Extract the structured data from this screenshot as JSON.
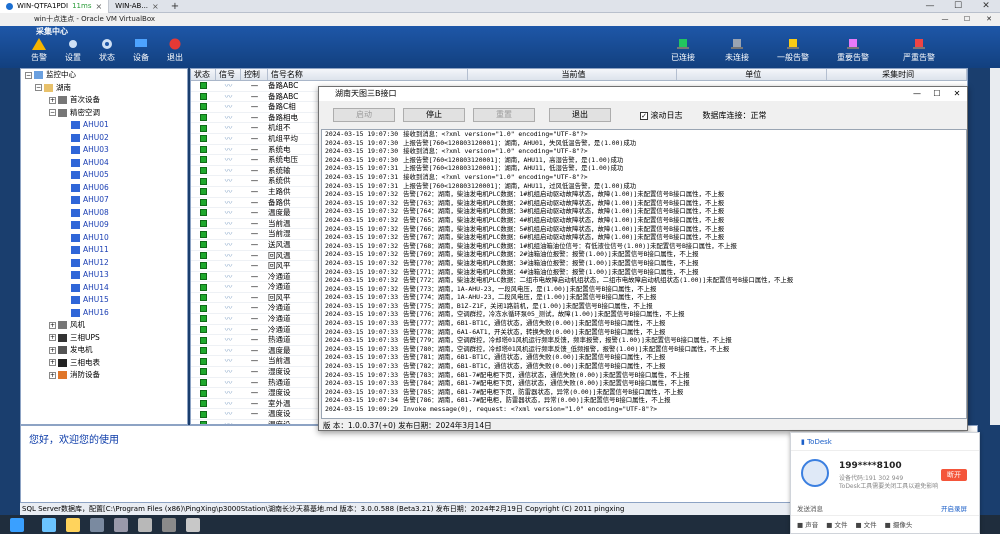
{
  "remote_bar": {
    "tab1": "WIN-QTFA1PDI",
    "ping": "11ms",
    "tab2": "WIN-AB...",
    "close": "×",
    "plus": "+",
    "win_min": "—",
    "win_max": "☐",
    "win_close": "✕"
  },
  "app_title": {
    "text": "win十点连点 - Oracle VM VirtualBox",
    "min": "—",
    "max": "☐",
    "close": "✕"
  },
  "app_header": {
    "name": "采集中心"
  },
  "toolbar": [
    {
      "label": "告警",
      "color": "#f4b400"
    },
    {
      "label": "设置",
      "color": "#cfe0f5"
    },
    {
      "label": "状态",
      "color": "#cfe0f5"
    },
    {
      "label": "设备",
      "color": "#4da3ff"
    },
    {
      "label": "退出",
      "color": "#e53935"
    }
  ],
  "status_legend": [
    {
      "label": "已连接",
      "color": "#22c55e"
    },
    {
      "label": "未连接",
      "color": "#9aa4b2"
    },
    {
      "label": "一般告警",
      "color": "#facc15"
    },
    {
      "label": "重要告警",
      "color": "#e879f9"
    },
    {
      "label": "严重告警",
      "color": "#ef4444"
    }
  ],
  "tree": {
    "root": "监控中心",
    "hunan": "湖南",
    "dept": "首次设备",
    "ac": "精密空调",
    "ahus": [
      "AHU01",
      "AHU02",
      "AHU03",
      "AHU04",
      "AHU05",
      "AHU06",
      "AHU07",
      "AHU08",
      "AHU09",
      "AHU10",
      "AHU11",
      "AHU12",
      "AHU13",
      "AHU14",
      "AHU15",
      "AHU16"
    ],
    "fan": "风机",
    "ups": "三相UPS",
    "gen": "发电机",
    "power": "三相电表",
    "fire": "消防设备"
  },
  "grid": {
    "headers": [
      "状态",
      "信号",
      "控制",
      "信号名称",
      "当前值",
      "单位",
      "采集时间"
    ],
    "rows": [
      "备路ABC",
      "备路ABC",
      "备路C相",
      "备路相电",
      "机组不",
      "机组平均",
      "系统电",
      "系统电压",
      "系统输",
      "系统供",
      "主路供",
      "备路供",
      "温度最",
      "当前温",
      "当前湿",
      "送风温",
      "回风温",
      "回风平",
      "冷通道",
      "冷通道",
      "回风平",
      "冷通道",
      "冷通道",
      "冷通道",
      "热通道",
      "温度最",
      "当前温",
      "湿度设",
      "热通道",
      "湿度设",
      "室外温",
      "温度设",
      "湿度设",
      "压缩机",
      "压缩机"
    ]
  },
  "message": "您好，欢迎您的使用",
  "statusbar": "SQL Server数据库，配置[C:\\Program Files (x86)\\PingXing\\p3000Station\\湖南长沙天慕基地.md 版本：3.0.0.588 (Beta3.21)   发布日期：2024年2月19日 Copyright (C) 2011 pingxing",
  "dialog": {
    "title": "湖南天图三B接口",
    "btn_start": "启动",
    "btn_stop": "停止",
    "btn_reset": "重置",
    "btn_exit": "退出",
    "chk_label": "滚动日志",
    "chk_mark": "✓",
    "conn": "数据库连接：正常",
    "version": "版 本：1.0.0.37(+0) 发布日期：2024年3月14日",
    "logs": [
      {
        "t": "2024-03-15 19:07:30",
        "m": "接收到消息：<?xml version=\"1.0\" encoding=\"UTF-8\"?>"
      },
      {
        "t": "2024-03-15 19:07:30",
        "m": "上报告警[760<120803120001]：湖南，AHU01，失风低温告警，是(1.00)成功"
      },
      {
        "t": "2024-03-15 19:07:30",
        "m": "接收到消息：<?xml version=\"1.0\" encoding=\"UTF-8\"?>"
      },
      {
        "t": "2024-03-15 19:07:30",
        "m": "上报告警[760<120803120001]：湖南，AHU11，高湿告警，是(1.00)成功"
      },
      {
        "t": "2024-03-15 19:07:31",
        "m": "上报告警[760<120803120001]：湖南，AHU11，低湿告警，是(1.00)成功"
      },
      {
        "t": "2024-03-15 19:07:31",
        "m": "接收到消息：<?xml version=\"1.0\" encoding=\"UTF-8\"?>"
      },
      {
        "t": "2024-03-15 19:07:31",
        "m": "上报告警[760<120803120001]：湖南，AHU11，过风低温告警，是(1.00)成功"
      },
      {
        "t": "2024-03-15 19:07:32",
        "m": "告警[762：湖南，柴油发电机PLC数据：1#机组启动驱动故障状态，故障(1.00)]未配置信号B接口属性，不上报"
      },
      {
        "t": "2024-03-15 19:07:32",
        "m": "告警[763：湖南，柴油发电机PLC数据：2#机组启动驱动故障状态，故障(1.00)]未配置信号B接口属性，不上报"
      },
      {
        "t": "2024-03-15 19:07:32",
        "m": "告警[764：湖南，柴油发电机PLC数据：3#机组启动驱动故障状态，故障(1.00)]未配置信号B接口属性，不上报"
      },
      {
        "t": "2024-03-15 19:07:32",
        "m": "告警[765：湖南，柴油发电机PLC数据：4#机组启动驱动故障状态，故障(1.00)]未配置信号B接口属性，不上报"
      },
      {
        "t": "2024-03-15 19:07:32",
        "m": "告警[766：湖南，柴油发电机PLC数据：5#机组启动驱动故障状态，故障(1.00)]未配置信号B接口属性，不上报"
      },
      {
        "t": "2024-03-15 19:07:32",
        "m": "告警[767：湖南，柴油发电机PLC数据：6#机组启动驱动故障状态，故障(1.00)]未配置信号B接口属性，不上报"
      },
      {
        "t": "2024-03-15 19:07:32",
        "m": "告警[768：湖南，柴油发电机PLC数据：1#机组油箱油位信号：有低液位信号(1.00)]未配置信号B接口属性，不上报"
      },
      {
        "t": "2024-03-15 19:07:32",
        "m": "告警[769：湖南，柴油发电机PLC数据：2#油箱油位报警：报警(1.00)]未配置信号B接口属性，不上报"
      },
      {
        "t": "2024-03-15 19:07:32",
        "m": "告警[770：湖南，柴油发电机PLC数据：3#油箱油位报警：报警(1.00)]未配置信号B接口属性，不上报"
      },
      {
        "t": "2024-03-15 19:07:32",
        "m": "告警[771：湖南，柴油发电机PLC数据：4#油箱油位报警：报警(1.00)]未配置信号B接口属性，不上报"
      },
      {
        "t": "2024-03-15 19:07:32",
        "m": "告警[772：湖南，柴油发电机PLC数据：二组市电故障启动机组状态，二组市电故障启动机组状态(1.00)]未配置信号B接口属性，不上报"
      },
      {
        "t": "2024-03-15 19:07:32",
        "m": "告警[773：湖南，1A-AHU-23，一段风电压，是(1.00)]未配置信号B接口属性，不上报"
      },
      {
        "t": "2024-03-15 19:07:33",
        "m": "告警[774：湖南，1A-AHU-23，二段风电压，是(1.00)]未配置信号B接口属性，不上报"
      },
      {
        "t": "2024-03-15 19:07:33",
        "m": "告警[775：湖南，B1Z-Z1F，关闭1路前机，是(1.00)]未配置信号B接口属性，不上报"
      },
      {
        "t": "2024-03-15 19:07:33",
        "m": "告警[776：湖南，空调群控，冷冻水循环泵05_测试，故障(1.00)]未配置信号B接口属性，不上报"
      },
      {
        "t": "2024-03-15 19:07:33",
        "m": "告警[777：湖南，6B1-BT1C，通信状态，通信失败(0.00)]未配置信号B接口属性，不上报"
      },
      {
        "t": "2024-03-15 19:07:33",
        "m": "告警[778：湖南，6A1-6AT1，开关状态，转换失败(0.00)]未配置信号B接口属性，不上报"
      },
      {
        "t": "2024-03-15 19:07:33",
        "m": "告警[779：湖南，空调群控，冷却塔01风机运行频率反馈，频率报警，报警(1.00)]未配置信号B接口属性，不上报"
      },
      {
        "t": "2024-03-15 19:07:33",
        "m": "告警[780：湖南，空调群控，冷却塔01风机运行频率反馈_低频报警，报警(1.00)]未配置信号B接口属性，不上报"
      },
      {
        "t": "2024-03-15 19:07:33",
        "m": "告警[781：湖南，6B1-BT1C，通信状态，通信失败(0.00)]未配置信号B接口属性，不上报"
      },
      {
        "t": "2024-03-15 19:07:33",
        "m": "告警[782：湖南，6B1-BT1C，通信状态，通信失败(0.00)]未配置信号B接口属性，不上报"
      },
      {
        "t": "2024-03-15 19:07:33",
        "m": "告警[783：湖南，6B1-7#配电柜下页，通信状态，通信失败(0.00)]未配置信号B接口属性，不上报"
      },
      {
        "t": "2024-03-15 19:07:33",
        "m": "告警[784：湖南，6B1-7#配电柜下页，通信状态，通信失败(0.00)]未配置信号B接口属性，不上报"
      },
      {
        "t": "2024-03-15 19:07:33",
        "m": "告警[785：湖南，6B1-7#配电柜下页，防雷器状态，异常(0.00)]未配置信号B接口属性，不上报"
      },
      {
        "t": "2024-03-15 19:07:34",
        "m": "告警[786：湖南，6B1-7#配电柜，防雷器状态，异常(0.00)]未配置信号B接口属性，不上报"
      },
      {
        "t": "2024-03-15 19:09:29",
        "m": "Invoke message(0), request: <?xml version=\"1.0\" encoding=\"UTF-8\"?>"
      }
    ]
  },
  "todesk": {
    "brand": "ToDesk",
    "name": "199****8100",
    "sub": "设备代码:191 302 949",
    "sub2": "ToDesk工具需要关闭工具以避免影响",
    "end": "断开",
    "chat": "发送消息",
    "record": "开启录屏",
    "footer": [
      "声音",
      "文件",
      "文件",
      "摄像头"
    ]
  }
}
